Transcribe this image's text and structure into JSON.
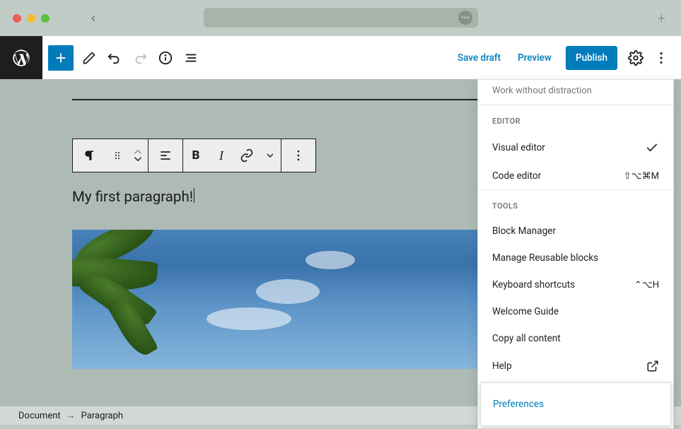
{
  "titlebar": {
    "url_dots": "•••"
  },
  "toolbar": {
    "save_draft": "Save draft",
    "preview": "Preview",
    "publish": "Publish"
  },
  "block": {
    "paragraph_text": "My first paragraph!"
  },
  "breadcrumb": {
    "root": "Document",
    "current": "Paragraph"
  },
  "menu": {
    "fade_top": "Work without distraction",
    "editor_heading": "EDITOR",
    "visual_editor": "Visual editor",
    "code_editor": "Code editor",
    "code_editor_shortcut": "⇧⌥⌘M",
    "tools_heading": "TOOLS",
    "block_manager": "Block Manager",
    "manage_reusable": "Manage Reusable blocks",
    "keyboard_shortcuts": "Keyboard shortcuts",
    "keyboard_shortcut_keys": "⌃⌥H",
    "welcome_guide": "Welcome Guide",
    "copy_all": "Copy all content",
    "help": "Help",
    "preferences": "Preferences"
  }
}
